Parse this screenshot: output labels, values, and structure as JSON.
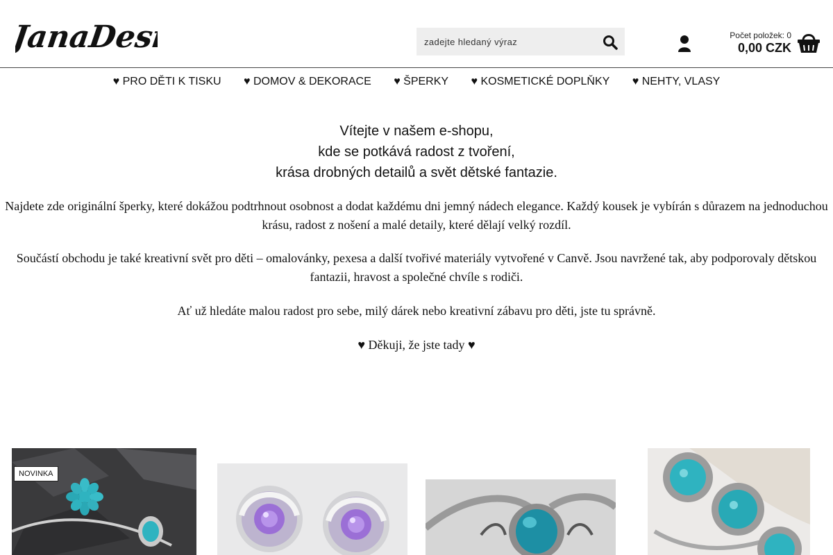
{
  "header": {
    "logo_text": "JanaDesign",
    "search": {
      "placeholder": "zadejte hledaný výraz"
    },
    "cart": {
      "count_label": "Počet položek: 0",
      "total": "0,00 CZK"
    }
  },
  "nav": {
    "items": [
      {
        "label": "♥ PRO DĚTI K TISKU"
      },
      {
        "label": "♥ DOMOV & DEKORACE"
      },
      {
        "label": "♥ ŠPERKY"
      },
      {
        "label": "♥ KOSMETICKÉ DOPLŇKY"
      },
      {
        "label": "♥ NEHTY, VLASY"
      }
    ]
  },
  "intro": {
    "welcome_lines": [
      "Vítejte v našem e-shopu,",
      "kde se potkává radost z tvoření,",
      "krása drobných detailů a svět dětské fantazie."
    ],
    "paragraphs": [
      "Najdete zde originální šperky, které dokážou podtrhnout osobnost a dodat každému dni jemný nádech elegance. Každý kousek je vybírán  s důrazem na jednoduchou krásu, radost z nošení a malé detaily, které dělají velký rozdíl.",
      "Součástí obchodu je také kreativní svět pro děti – omalovánky, pexesa a další tvořivé materiály vytvořené v Canvě. Jsou navržené tak, aby podporovaly dětskou fantazii, hravost a společné chvíle s rodiči.",
      "Ať už hledáte malou radost pro sebe, milý dárek nebo kreativní zábavu pro děti, jste tu správně.",
      "♥ Děkuji, že jste tady ♥"
    ]
  },
  "products": [
    {
      "badge": "NOVINKA"
    },
    {
      "badge": ""
    },
    {
      "badge": ""
    },
    {
      "badge": ""
    }
  ],
  "colors": {
    "turquoise": "#2fb3c0",
    "purple": "#9b6fd6",
    "border": "#444444"
  },
  "icons": {
    "search": "search-icon",
    "user": "user-icon",
    "cart": "basket-icon"
  }
}
